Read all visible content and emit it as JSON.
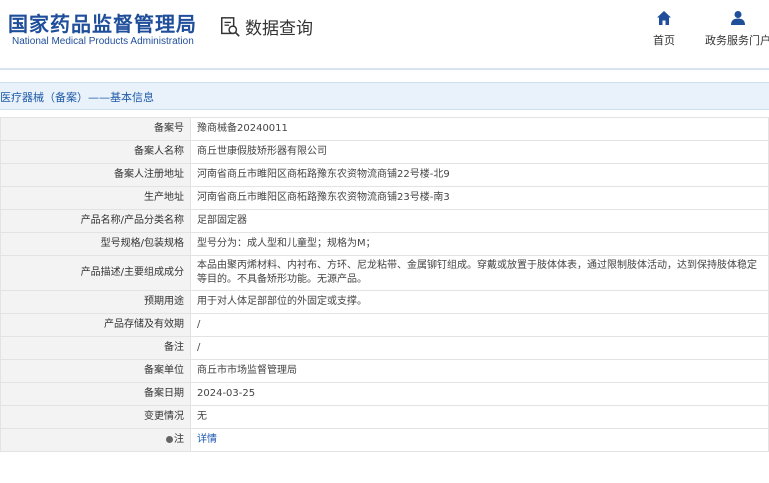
{
  "header": {
    "agency_cn": "国家药品监督管理局",
    "agency_en": "National Medical Products Administration",
    "query_title": "数据查询",
    "nav": [
      {
        "label": "首页",
        "icon": "home-icon"
      },
      {
        "label": "政务服务门户",
        "icon": "user-icon"
      }
    ]
  },
  "breadcrumb": "医疗器械（备案）——基本信息",
  "rows": [
    {
      "label": "备案号",
      "value": "豫商械备20240011"
    },
    {
      "label": "备案人名称",
      "value": "商丘世康假肢矫形器有限公司"
    },
    {
      "label": "备案人注册地址",
      "value": "河南省商丘市睢阳区商柘路豫东农资物流商铺22号楼-北9"
    },
    {
      "label": "生产地址",
      "value": "河南省商丘市睢阳区商柘路豫东农资物流商铺23号楼-南3"
    },
    {
      "label": "产品名称/产品分类名称",
      "value": "足部固定器"
    },
    {
      "label": "型号规格/包装规格",
      "value": "型号分为：成人型和儿童型；规格为M；"
    },
    {
      "label": "产品描述/主要组成成分",
      "value": "本品由聚丙烯材料、内衬布、方环、尼龙粘带、金属铆钉组成。穿戴或放置于肢体体表，通过限制肢体活动，达到保持肢体稳定等目的。不具备矫形功能。无源产品。"
    },
    {
      "label": "预期用途",
      "value": "用于对人体足部部位的外固定或支撑。"
    },
    {
      "label": "产品存储及有效期",
      "value": "/"
    },
    {
      "label": "备注",
      "value": "/"
    },
    {
      "label": "备案单位",
      "value": "商丘市市场监督管理局"
    },
    {
      "label": "备案日期",
      "value": "2024-03-25"
    },
    {
      "label": "变更情况",
      "value": "无"
    },
    {
      "label": "注",
      "value": "详情"
    }
  ],
  "colors": {
    "brand": "#1f4e9a",
    "link": "#1a56b0",
    "crumb_bg": "#e9f1fa"
  }
}
